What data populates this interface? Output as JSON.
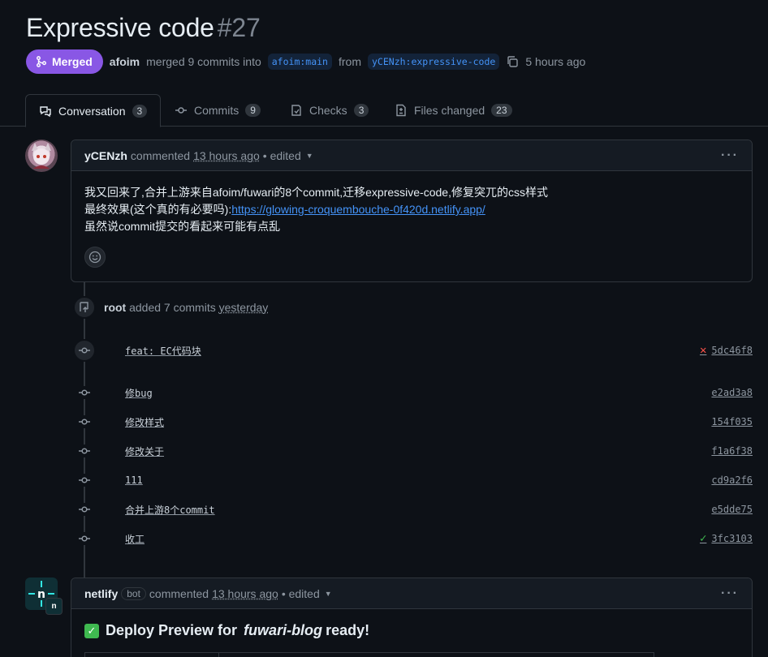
{
  "pr": {
    "title": "Expressive code",
    "number": "#27",
    "status_label": "Merged",
    "merger": "afoim",
    "merge_text": "merged 9 commits into",
    "base_branch": "afoim:main",
    "from_text": "from",
    "head_branch": "yCENzh:expressive-code",
    "time": "5 hours ago"
  },
  "tabs": [
    {
      "label": "Conversation",
      "count": "3"
    },
    {
      "label": "Commits",
      "count": "9"
    },
    {
      "label": "Checks",
      "count": "3"
    },
    {
      "label": "Files changed",
      "count": "23"
    }
  ],
  "comment1": {
    "author": "yCENzh",
    "action": "commented",
    "time": "13 hours ago",
    "edited": "• edited",
    "line1": "我又回来了,合并上游来自afoim/fuwari的8个commit,迁移expressive-code,修复突兀的css样式",
    "line2_prefix": "最终效果(这个真的有必要吗):",
    "link": "https://glowing-croquembouche-0f420d.netlify.app/",
    "line3": "虽然说commit提交的看起来可能有点乱"
  },
  "event": {
    "actor": "root",
    "text": "added 7 commits",
    "time": "yesterday"
  },
  "commits": [
    {
      "message": "feat: EC代码块",
      "sha": "5dc46f8",
      "status": "fail"
    },
    {
      "message": "修bug",
      "sha": "e2ad3a8",
      "status": ""
    },
    {
      "message": "修改样式",
      "sha": "154f035",
      "status": ""
    },
    {
      "message": "修改关于",
      "sha": "f1a6f38",
      "status": ""
    },
    {
      "message": "111",
      "sha": "cd9a2f6",
      "status": ""
    },
    {
      "message": "合并上游8个commit",
      "sha": "e5dde75",
      "status": ""
    },
    {
      "message": "收工",
      "sha": "3fc3103",
      "status": "success"
    }
  ],
  "comment2": {
    "author": "netlify",
    "bot_tag": "bot",
    "action": "commented",
    "time": "13 hours ago",
    "edited": "• edited",
    "deploy_prefix": "Deploy Preview for",
    "deploy_site": "fuwari-blog",
    "deploy_suffix": "ready!"
  },
  "colors": {
    "merged": "#8957e5",
    "link": "#4493f8",
    "success": "#3fb950",
    "danger": "#f85149",
    "netlify": "#0f2f35"
  }
}
